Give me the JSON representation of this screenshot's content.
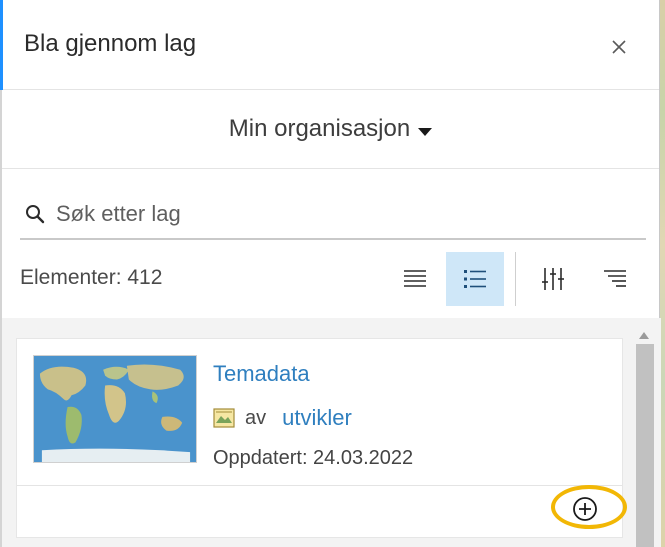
{
  "panel": {
    "title": "Bla gjennom lag",
    "close_icon": "close-icon",
    "accent_color": "#1e90ff"
  },
  "source": {
    "selected": "Min organisasjon",
    "icon": "caret-down-icon"
  },
  "search": {
    "placeholder": "Søk etter lag",
    "value": "",
    "icon": "search-icon"
  },
  "toolbar": {
    "count_text": "Elementer: 412",
    "buttons": [
      {
        "name": "compact-list-view",
        "icon": "list-icon",
        "active": false
      },
      {
        "name": "detailed-list-view",
        "icon": "detailed-list-icon",
        "active": true
      },
      {
        "name": "filter",
        "icon": "sliders-icon",
        "active": false
      },
      {
        "name": "sort",
        "icon": "sort-icon",
        "active": false
      }
    ],
    "active_color": "#cfe7f8"
  },
  "items": [
    {
      "title": "Temadata",
      "type_icon": "map-layer-icon",
      "by_label": "av",
      "owner": "utvikler",
      "updated": "Oppdatert: 24.03.2022",
      "action_icon": "add-circle-icon",
      "link_color": "#2f7fbf"
    }
  ],
  "highlight_color": "#f2b705"
}
